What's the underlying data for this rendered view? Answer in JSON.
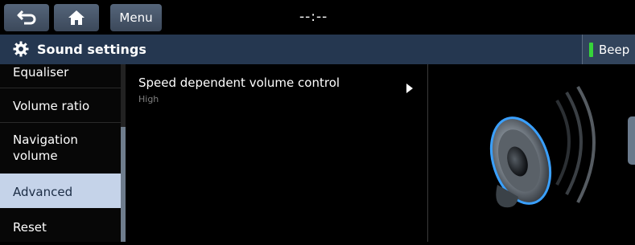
{
  "topbar": {
    "back_icon": "back-arrow-icon",
    "home_icon": "home-icon",
    "menu_label": "Menu",
    "clock": "--:--"
  },
  "header": {
    "icon": "gear-icon",
    "title": "Sound settings",
    "beep_label": "Beep",
    "beep_indicator_color": "#36d43a"
  },
  "sidebar": {
    "items": [
      {
        "label": "Equaliser"
      },
      {
        "label": "Volume ratio"
      },
      {
        "label": "Navigation\nvolume"
      },
      {
        "label": "Advanced",
        "selected": true
      },
      {
        "label": "Reset"
      }
    ]
  },
  "content": {
    "rows": [
      {
        "title": "Speed dependent volume control",
        "value": "High"
      }
    ]
  },
  "colors": {
    "header_bg": "#253750",
    "selected_bg": "#c5d3e9",
    "speaker_ring": "#3aa0ff"
  }
}
